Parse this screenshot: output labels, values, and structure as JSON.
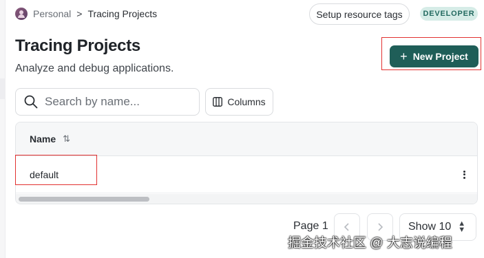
{
  "breadcrumb": {
    "workspace": "Personal",
    "separator": ">",
    "current": "Tracing Projects"
  },
  "header": {
    "setup_tags_label": "Setup resource tags",
    "role_badge": "DEVELOPER",
    "title": "Tracing Projects",
    "subtitle": "Analyze and debug applications.",
    "new_project_label": "New Project",
    "new_project_icon": "plus-icon"
  },
  "toolbar": {
    "search_placeholder": "Search by name...",
    "search_icon": "search-icon",
    "columns_label": "Columns",
    "columns_icon": "columns-icon"
  },
  "table": {
    "columns": [
      "Name"
    ],
    "sort_icon": "sort-icon",
    "rows": [
      {
        "name": "default"
      }
    ]
  },
  "pagination": {
    "page_label": "Page 1",
    "show_label": "Show 10"
  },
  "watermark": "掘金技术社区 @ 大志说编程",
  "colors": {
    "primary": "#1f5e58",
    "badge_bg": "#d6ece7",
    "badge_text": "#22695f",
    "highlight": "#e2302f"
  }
}
